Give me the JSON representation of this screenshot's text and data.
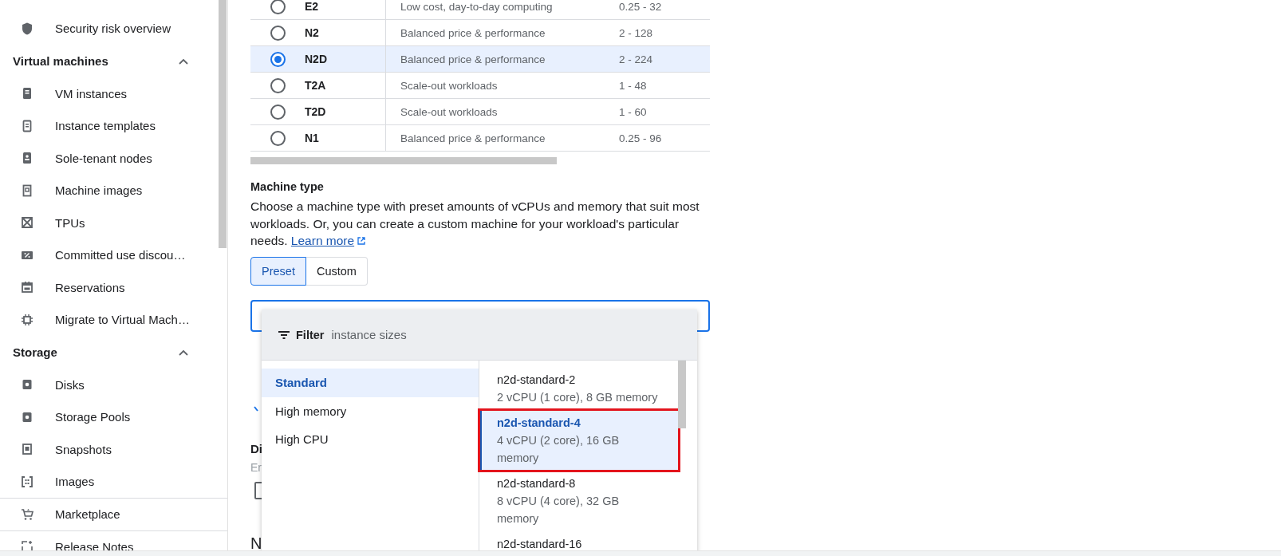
{
  "sidebar": {
    "sections": [
      {
        "items": [
          {
            "label": "Security risk overview"
          }
        ]
      },
      {
        "title": "Virtual machines",
        "expanded": true,
        "items": [
          {
            "label": "VM instances"
          },
          {
            "label": "Instance templates"
          },
          {
            "label": "Sole-tenant nodes"
          },
          {
            "label": "Machine images"
          },
          {
            "label": "TPUs"
          },
          {
            "label": "Committed use discou…"
          },
          {
            "label": "Reservations"
          },
          {
            "label": "Migrate to Virtual Mach…"
          }
        ]
      },
      {
        "title": "Storage",
        "expanded": true,
        "items": [
          {
            "label": "Disks"
          },
          {
            "label": "Storage Pools"
          },
          {
            "label": "Snapshots"
          },
          {
            "label": "Images"
          }
        ]
      }
    ],
    "footer_items": [
      {
        "label": "Marketplace"
      },
      {
        "label": "Release Notes"
      }
    ]
  },
  "series_table": {
    "rows": [
      {
        "name": "E2",
        "description": "Low cost, day-to-day computing",
        "vcpus": "0.25 - 32",
        "selected": false
      },
      {
        "name": "N2",
        "description": "Balanced price & performance",
        "vcpus": "2 - 128",
        "selected": false
      },
      {
        "name": "N2D",
        "description": "Balanced price & performance",
        "vcpus": "2 - 224",
        "selected": true
      },
      {
        "name": "T2A",
        "description": "Scale-out workloads",
        "vcpus": "1 - 48",
        "selected": false
      },
      {
        "name": "T2D",
        "description": "Scale-out workloads",
        "vcpus": "1 - 60",
        "selected": false
      },
      {
        "name": "N1",
        "description": "Balanced price & performance",
        "vcpus": "0.25 - 96",
        "selected": false
      }
    ]
  },
  "machine_type": {
    "title": "Machine type",
    "description": "Choose a machine type with preset amounts of vCPUs and memory that suit most workloads. Or, you can create a custom machine for your workload's particular needs.",
    "link": "Learn more",
    "modes": [
      {
        "label": "Preset",
        "selected": true
      },
      {
        "label": "Custom",
        "selected": false
      }
    ]
  },
  "covered": [
    {
      "kind": "chevron"
    },
    {
      "kind": "label",
      "text": "Di"
    },
    {
      "kind": "placeholder",
      "text": "Er"
    },
    {
      "kind": "checkbox",
      "checked": false
    },
    {
      "kind": "label",
      "text": "N"
    }
  ],
  "dropdown": {
    "filter_label": "Filter",
    "filter_placeholder": "instance sizes",
    "categories": [
      {
        "label": "Standard",
        "selected": true
      },
      {
        "label": "High memory",
        "selected": false
      },
      {
        "label": "High CPU",
        "selected": false
      }
    ],
    "options": [
      {
        "name": "n2d-standard-2",
        "details": "2 vCPU (1 core), 8 GB memory",
        "selected": false,
        "highlighted": false
      },
      {
        "name": "n2d-standard-4",
        "details": "4 vCPU (2 core), 16 GB memory",
        "selected": true,
        "highlighted": true
      },
      {
        "name": "n2d-standard-8",
        "details": "8 vCPU (4 core), 32 GB memory",
        "selected": false,
        "highlighted": false
      },
      {
        "name": "n2d-standard-16",
        "selected": false,
        "highlighted": false
      }
    ]
  }
}
